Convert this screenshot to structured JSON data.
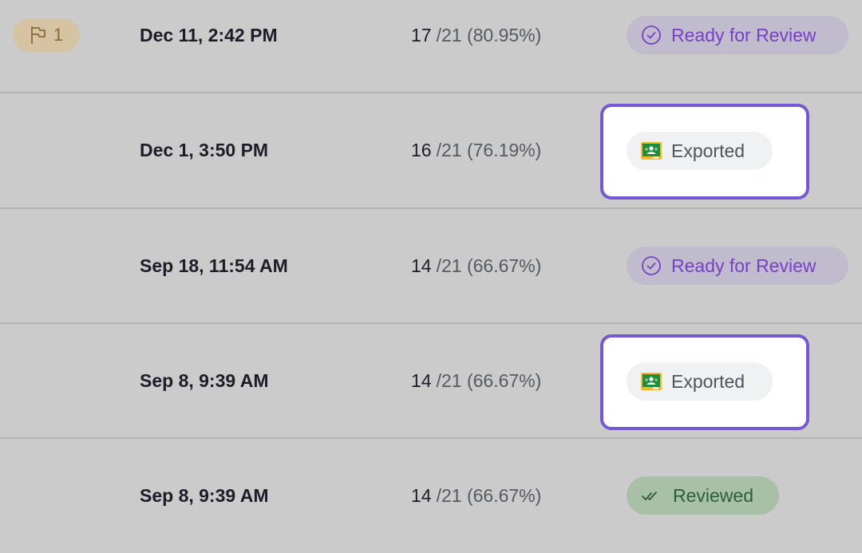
{
  "rows": [
    {
      "flag": {
        "icon": "flag-icon",
        "count": "1"
      },
      "date": "Dec 11, 2:42 PM",
      "score": {
        "correct": "17",
        "detail": "/21 (80.95%)"
      },
      "status": {
        "label": "Ready for Review",
        "icon": "check-circle-icon"
      }
    },
    {
      "date": "Dec 1, 3:50 PM",
      "score": {
        "correct": "16",
        "detail": "/21 (76.19%)"
      },
      "status": {
        "label": "Exported",
        "icon": "google-classroom-icon"
      }
    },
    {
      "date": "Sep 18, 11:54 AM",
      "score": {
        "correct": "14",
        "detail": "/21 (66.67%)"
      },
      "status": {
        "label": "Ready for Review",
        "icon": "check-circle-icon"
      }
    },
    {
      "date": "Sep 8, 9:39 AM",
      "score": {
        "correct": "14",
        "detail": "/21 (66.67%)"
      },
      "status": {
        "label": "Exported",
        "icon": "google-classroom-icon"
      }
    },
    {
      "date": "Sep 8, 9:39 AM",
      "score": {
        "correct": "14",
        "detail": "/21 (66.67%)"
      },
      "status": {
        "label": "Reviewed",
        "icon": "double-check-icon"
      }
    }
  ],
  "colors": {
    "ready_for_review": "#7640c9",
    "reviewed": "#2d6133",
    "exported_highlight": "#7658d4",
    "flag": "#8a6a3a"
  }
}
